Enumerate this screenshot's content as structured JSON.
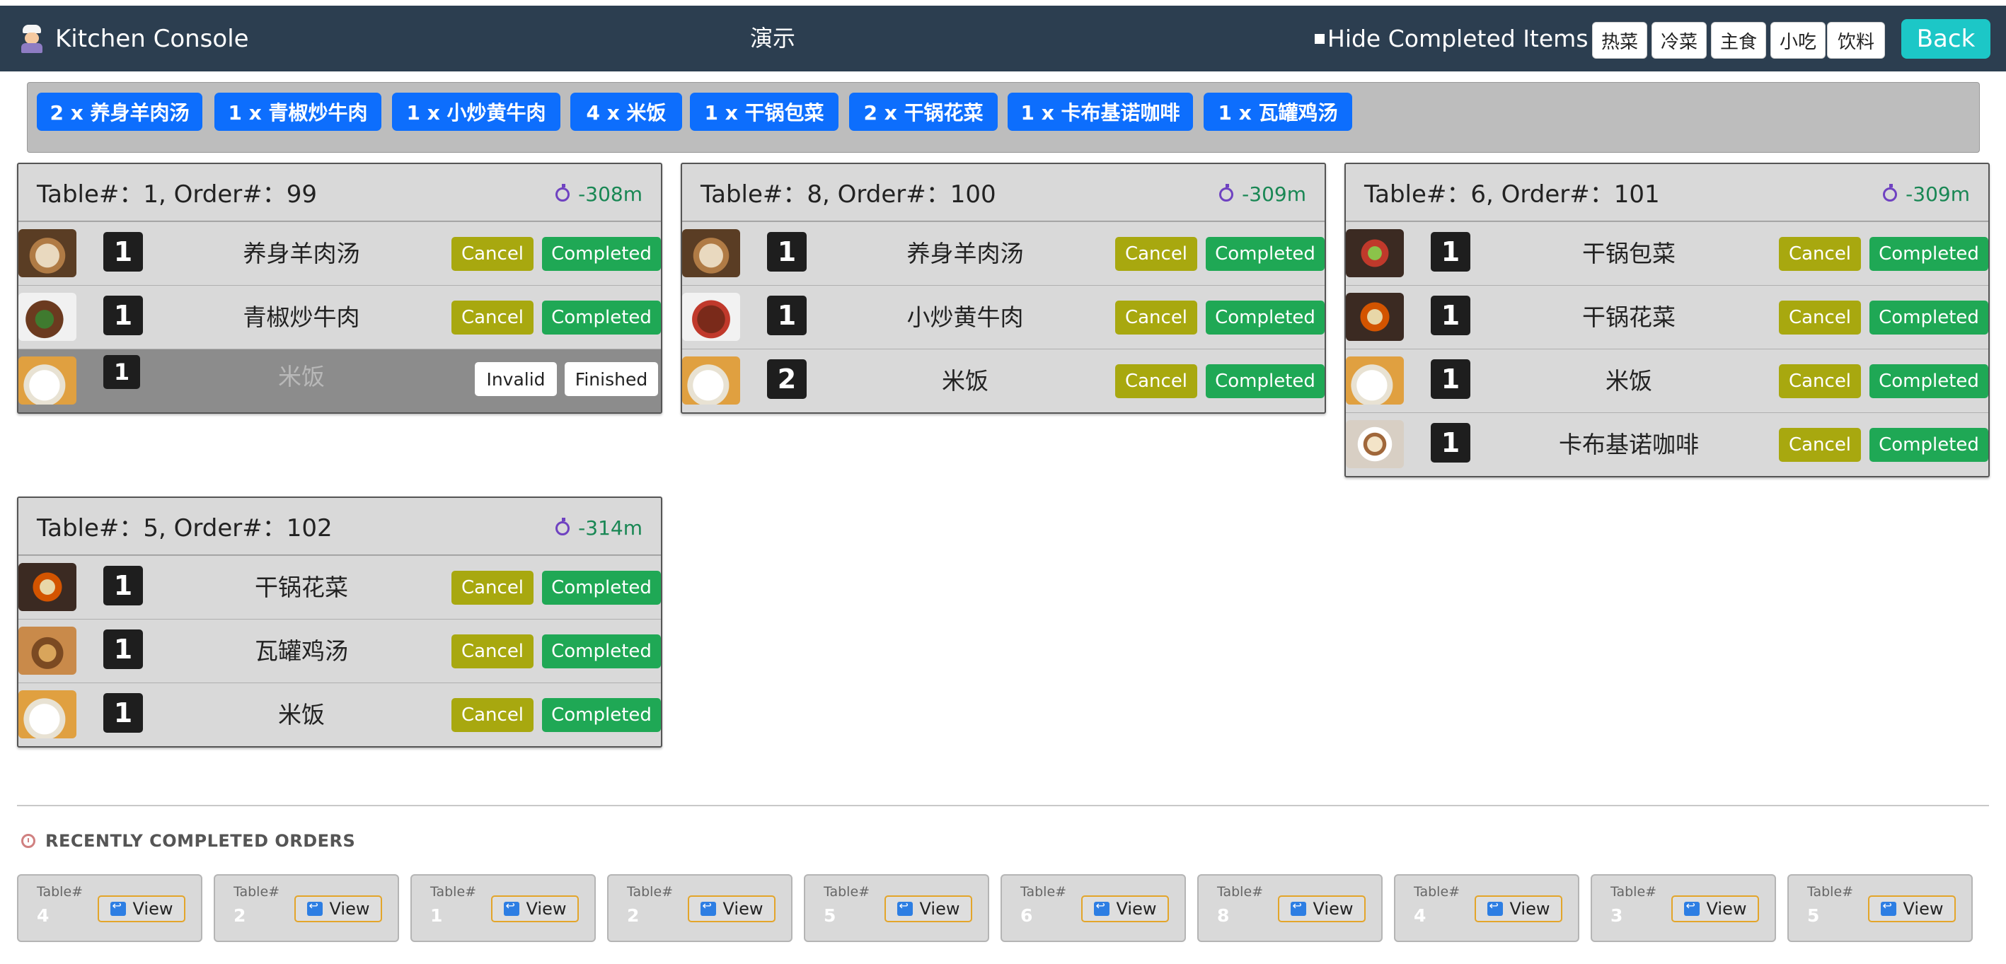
{
  "header": {
    "title": "Kitchen Console",
    "center_title": "演示",
    "hide_completed_label": "Hide Completed Items",
    "categories": [
      "热菜",
      "冷菜",
      "主食",
      "小吃",
      "饮料"
    ],
    "back_label": "Back"
  },
  "summary": [
    "2 x 养身羊肉汤",
    "1 x 青椒炒牛肉",
    "1 x 小炒黄牛肉",
    "4 x 米饭",
    "1 x 干锅包菜",
    "2 x 干锅花菜",
    "1 x 卡布基诺咖啡",
    "1 x 瓦罐鸡汤"
  ],
  "labels": {
    "cancel": "Cancel",
    "completed": "Completed",
    "invalid": "Invalid",
    "finished": "Finished",
    "view": "View",
    "table_short": "Table#"
  },
  "orders": [
    {
      "title": "Table#：1, Order#：99",
      "time": "-308m",
      "items": [
        {
          "qty": "1",
          "name": "养身羊肉汤",
          "thumb": "soup-icon",
          "status": "active"
        },
        {
          "qty": "1",
          "name": "青椒炒牛肉",
          "thumb": "beef-icon",
          "status": "active"
        },
        {
          "qty": "1",
          "name": "米饭",
          "thumb": "rice-icon",
          "status": "invalid"
        }
      ]
    },
    {
      "title": "Table#：8, Order#：100",
      "time": "-309m",
      "items": [
        {
          "qty": "1",
          "name": "养身羊肉汤",
          "thumb": "soup-icon",
          "status": "active"
        },
        {
          "qty": "1",
          "name": "小炒黄牛肉",
          "thumb": "beef-icon",
          "status": "active"
        },
        {
          "qty": "2",
          "name": "米饭",
          "thumb": "rice-icon",
          "status": "active"
        }
      ]
    },
    {
      "title": "Table#：6, Order#：101",
      "time": "-309m",
      "items": [
        {
          "qty": "1",
          "name": "干锅包菜",
          "thumb": "dry-pot-icon",
          "status": "active"
        },
        {
          "qty": "1",
          "name": "干锅花菜",
          "thumb": "dry-pot-icon",
          "status": "active"
        },
        {
          "qty": "1",
          "name": "米饭",
          "thumb": "rice-icon",
          "status": "active"
        },
        {
          "qty": "1",
          "name": "卡布基诺咖啡",
          "thumb": "coffee-icon",
          "status": "active"
        }
      ]
    },
    {
      "title": "Table#：5, Order#：102",
      "time": "-314m",
      "items": [
        {
          "qty": "1",
          "name": "干锅花菜",
          "thumb": "dry-pot-icon",
          "status": "active"
        },
        {
          "qty": "1",
          "name": "瓦罐鸡汤",
          "thumb": "clay-pot-soup-icon",
          "status": "active"
        },
        {
          "qty": "1",
          "name": "米饭",
          "thumb": "rice-icon",
          "status": "active"
        }
      ]
    }
  ],
  "recent": {
    "title": "RECENTLY COMPLETED ORDERS",
    "tables": [
      "4",
      "2",
      "1",
      "2",
      "5",
      "6",
      "8",
      "4",
      "3",
      "5"
    ]
  },
  "colors": {
    "header_bg": "#2c3e50",
    "pill": "#0d6efd",
    "cancel": "#a8a80f",
    "completed": "#1fa855",
    "back": "#1cc7c7",
    "timer": "#198754"
  }
}
